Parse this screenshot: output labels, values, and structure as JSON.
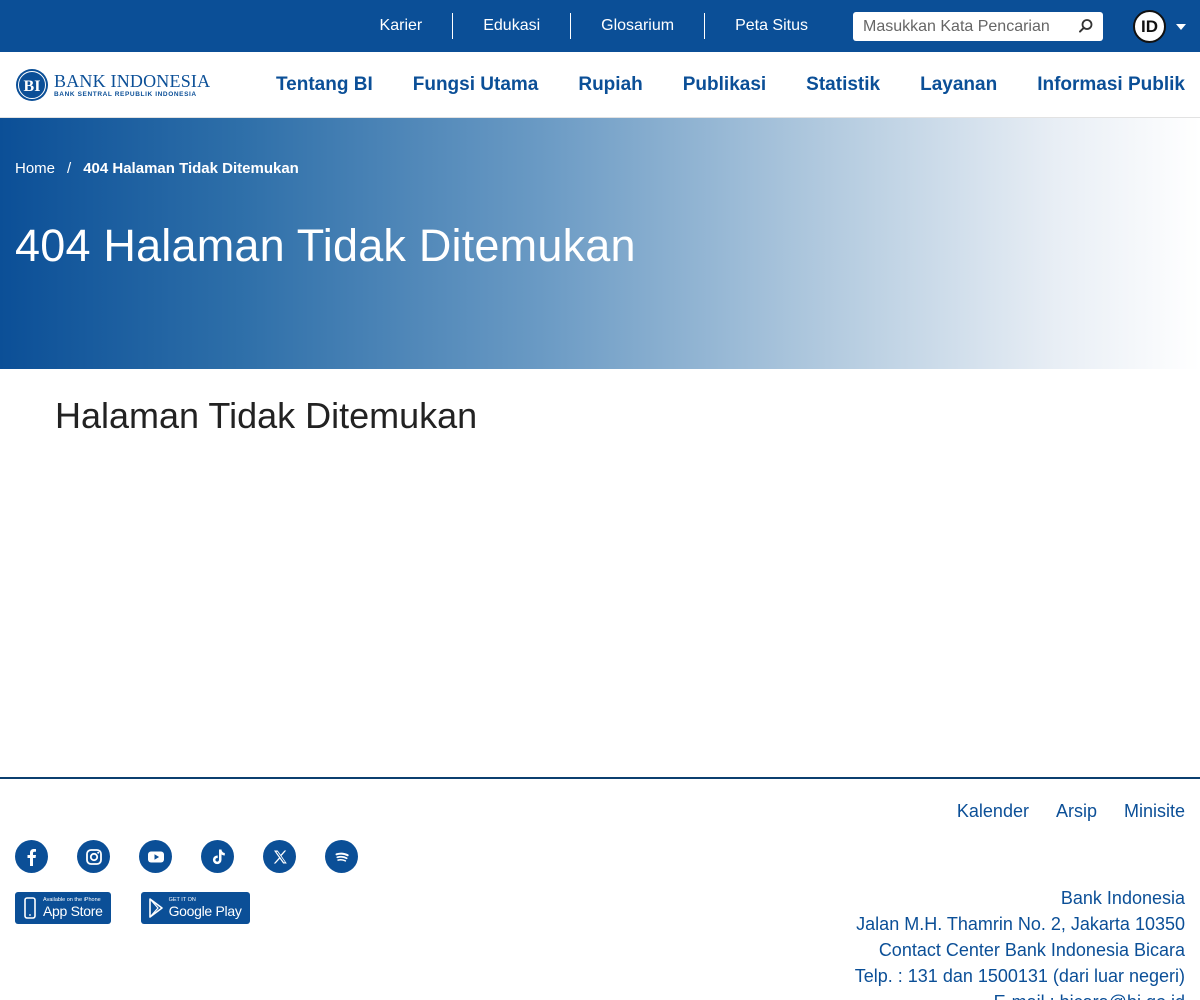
{
  "topbar": {
    "links": [
      "Karier",
      "Edukasi",
      "Glosarium",
      "Peta Situs"
    ],
    "search_placeholder": "Masukkan Kata Pencarian",
    "language": "ID"
  },
  "brand": {
    "name": "BANK INDONESIA",
    "tagline": "BANK SENTRAL REPUBLIK INDONESIA",
    "mark": "BI"
  },
  "nav": {
    "items": [
      "Tentang BI",
      "Fungsi Utama",
      "Rupiah",
      "Publikasi",
      "Statistik",
      "Layanan",
      "Informasi Publik"
    ]
  },
  "hero": {
    "breadcrumb_home": "Home",
    "breadcrumb_separator": "/",
    "breadcrumb_current": "404 Halaman Tidak Ditemukan",
    "title": "404 Halaman Tidak Ditemukan"
  },
  "main": {
    "heading": "Halaman Tidak Ditemukan"
  },
  "footer": {
    "links": [
      "Kalender",
      "Arsip",
      "Minisite"
    ],
    "socials": [
      "facebook-icon",
      "instagram-icon",
      "youtube-icon",
      "tiktok-icon",
      "x-icon",
      "spotify-icon"
    ],
    "stores": [
      {
        "small": "Available on the iPhone",
        "big": "App Store"
      },
      {
        "small": "GET IT ON",
        "big": "Google Play"
      }
    ],
    "address": [
      "Bank Indonesia",
      "Jalan M.H. Thamrin No. 2, Jakarta 10350",
      "Contact Center Bank Indonesia Bicara",
      "Telp. : 131 dan 1500131 (dari luar negeri)",
      "E-mail : bicara@bi.go.id"
    ]
  },
  "colors": {
    "brand_blue": "#0b4f97",
    "footer_border": "#0b3f6f"
  }
}
